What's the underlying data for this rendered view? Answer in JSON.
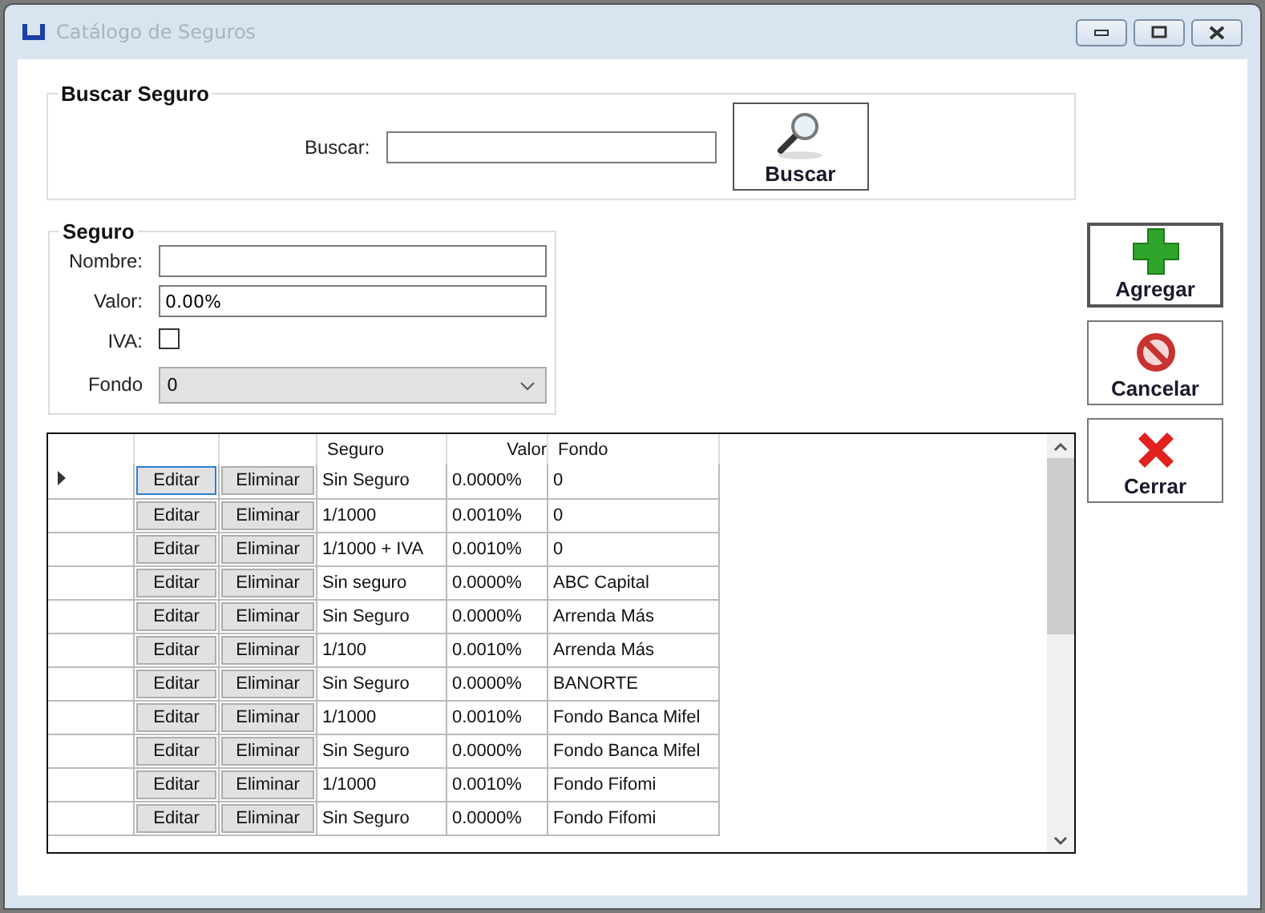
{
  "window": {
    "title": "Catálogo de Seguros"
  },
  "search_group": {
    "title": "Buscar Seguro",
    "label": "Buscar:",
    "button": "Buscar"
  },
  "seguro_group": {
    "title": "Seguro",
    "nombre_label": "Nombre:",
    "valor_label": "Valor:",
    "valor_value": "0.00%",
    "iva_label": "IVA:",
    "iva_checked": false,
    "fondo_label": "Fondo",
    "fondo_value": "0"
  },
  "actions": [
    {
      "label": "Agregar",
      "kind": "add",
      "default": true
    },
    {
      "label": "Cancelar",
      "kind": "cancel",
      "default": false
    },
    {
      "label": "Cerrar",
      "kind": "close",
      "default": false
    }
  ],
  "table": {
    "columns": [
      "Seguro",
      "Valor",
      "Fondo"
    ],
    "rows": [
      {
        "edit": "Editar",
        "delete": "Eliminar",
        "seguro": "Sin Seguro",
        "valor": "0.0000%",
        "fondo": "0",
        "selected": true
      },
      {
        "edit": "Editar",
        "delete": "Eliminar",
        "seguro": "1/1000",
        "valor": "0.0010%",
        "fondo": "0",
        "selected": false
      },
      {
        "edit": "Editar",
        "delete": "Eliminar",
        "seguro": "1/1000 + IVA",
        "valor": "0.0010%",
        "fondo": "0",
        "selected": false
      },
      {
        "edit": "Editar",
        "delete": "Eliminar",
        "seguro": "Sin seguro",
        "valor": "0.0000%",
        "fondo": "ABC Capital",
        "selected": false
      },
      {
        "edit": "Editar",
        "delete": "Eliminar",
        "seguro": "Sin Seguro",
        "valor": "0.0000%",
        "fondo": "Arrenda Más",
        "selected": false
      },
      {
        "edit": "Editar",
        "delete": "Eliminar",
        "seguro": "1/100",
        "valor": "0.0010%",
        "fondo": "Arrenda Más",
        "selected": false
      },
      {
        "edit": "Editar",
        "delete": "Eliminar",
        "seguro": "Sin Seguro",
        "valor": "0.0000%",
        "fondo": "BANORTE",
        "selected": false
      },
      {
        "edit": "Editar",
        "delete": "Eliminar",
        "seguro": "1/1000",
        "valor": "0.0010%",
        "fondo": "Fondo Banca Mifel",
        "selected": false
      },
      {
        "edit": "Editar",
        "delete": "Eliminar",
        "seguro": "Sin Seguro",
        "valor": "0.0000%",
        "fondo": "Fondo Banca Mifel",
        "selected": false
      },
      {
        "edit": "Editar",
        "delete": "Eliminar",
        "seguro": "1/1000",
        "valor": "0.0010%",
        "fondo": "Fondo Fifomi",
        "selected": false
      },
      {
        "edit": "Editar",
        "delete": "Eliminar",
        "seguro": "Sin Seguro",
        "valor": "0.0000%",
        "fondo": "Fondo Fifomi",
        "selected": false
      }
    ]
  }
}
